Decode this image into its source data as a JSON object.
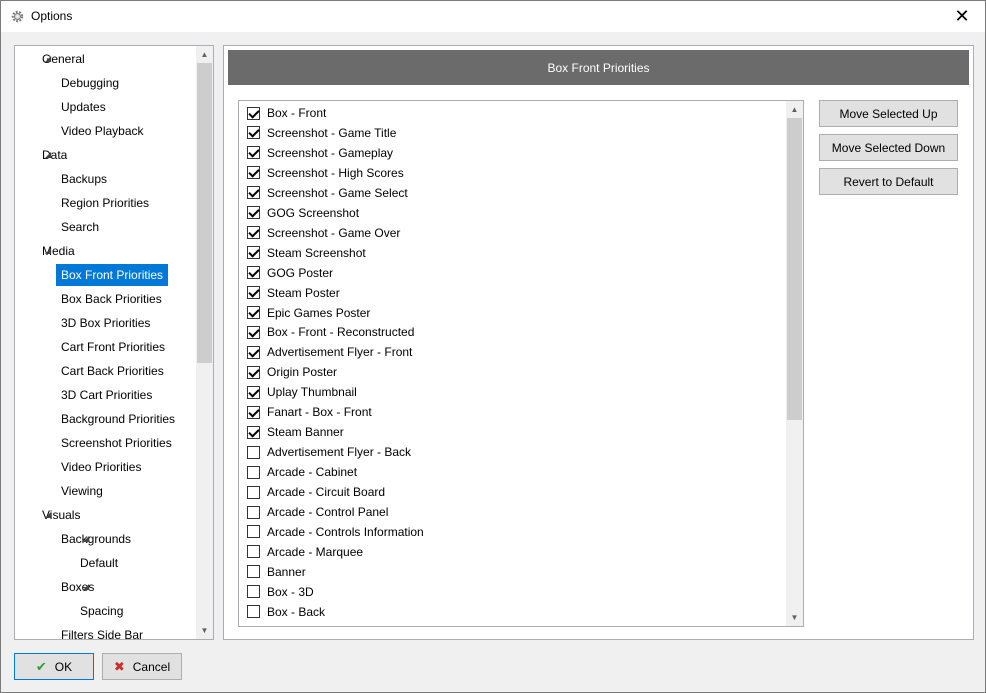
{
  "window": {
    "title": "Options",
    "close_glyph": "✕",
    "icon": "gear-icon"
  },
  "tree": {
    "items": [
      {
        "label": "General",
        "expanded": true
      },
      {
        "label": "Debugging"
      },
      {
        "label": "Updates"
      },
      {
        "label": "Video Playback"
      },
      {
        "label": "Data",
        "expanded": true
      },
      {
        "label": "Backups"
      },
      {
        "label": "Region Priorities"
      },
      {
        "label": "Search"
      },
      {
        "label": "Media",
        "expanded": true
      },
      {
        "label": "Box Front Priorities",
        "selected": true
      },
      {
        "label": "Box Back Priorities"
      },
      {
        "label": "3D Box Priorities"
      },
      {
        "label": "Cart Front Priorities"
      },
      {
        "label": "Cart Back Priorities"
      },
      {
        "label": "3D Cart Priorities"
      },
      {
        "label": "Background Priorities"
      },
      {
        "label": "Screenshot Priorities"
      },
      {
        "label": "Video Priorities"
      },
      {
        "label": "Viewing"
      },
      {
        "label": "Visuals",
        "expanded": true
      },
      {
        "label": "Backgrounds",
        "expanded": true
      },
      {
        "label": "Default"
      },
      {
        "label": "Boxes",
        "expanded": true
      },
      {
        "label": "Spacing"
      },
      {
        "label": "Filters Side Bar"
      }
    ]
  },
  "panel": {
    "header": "Box Front Priorities",
    "items": [
      {
        "label": "Box - Front",
        "checked": true
      },
      {
        "label": "Screenshot - Game Title",
        "checked": true
      },
      {
        "label": "Screenshot - Gameplay",
        "checked": true
      },
      {
        "label": "Screenshot - High Scores",
        "checked": true
      },
      {
        "label": "Screenshot - Game Select",
        "checked": true
      },
      {
        "label": "GOG Screenshot",
        "checked": true
      },
      {
        "label": "Screenshot - Game Over",
        "checked": true
      },
      {
        "label": "Steam Screenshot",
        "checked": true
      },
      {
        "label": "GOG Poster",
        "checked": true
      },
      {
        "label": "Steam Poster",
        "checked": true
      },
      {
        "label": "Epic Games Poster",
        "checked": true
      },
      {
        "label": "Box - Front - Reconstructed",
        "checked": true
      },
      {
        "label": "Advertisement Flyer - Front",
        "checked": true
      },
      {
        "label": "Origin Poster",
        "checked": true
      },
      {
        "label": "Uplay Thumbnail",
        "checked": true
      },
      {
        "label": "Fanart - Box - Front",
        "checked": true
      },
      {
        "label": "Steam Banner",
        "checked": true
      },
      {
        "label": "Advertisement Flyer - Back",
        "checked": false
      },
      {
        "label": "Arcade - Cabinet",
        "checked": false
      },
      {
        "label": "Arcade - Circuit Board",
        "checked": false
      },
      {
        "label": "Arcade - Control Panel",
        "checked": false
      },
      {
        "label": "Arcade - Controls Information",
        "checked": false
      },
      {
        "label": "Arcade - Marquee",
        "checked": false
      },
      {
        "label": "Banner",
        "checked": false
      },
      {
        "label": "Box - 3D",
        "checked": false
      },
      {
        "label": "Box - Back",
        "checked": false
      }
    ],
    "buttons": {
      "move_up": "Move Selected Up",
      "move_down": "Move Selected Down",
      "revert": "Revert to Default"
    }
  },
  "footer": {
    "ok": "OK",
    "cancel": "Cancel",
    "ok_glyph": "✔",
    "cancel_glyph": "✖",
    "ok_color": "#2e9e2e",
    "cancel_color": "#d02b2b"
  },
  "colors": {
    "selection": "#0078d7",
    "header_bg": "#6b6b6b"
  }
}
